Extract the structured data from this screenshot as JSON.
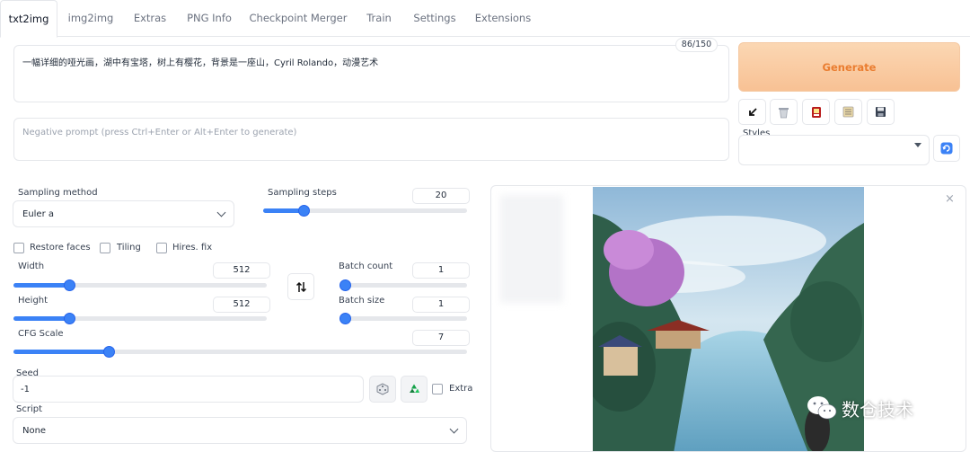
{
  "tabs": [
    {
      "label": "txt2img",
      "active": true
    },
    {
      "label": "img2img"
    },
    {
      "label": "Extras"
    },
    {
      "label": "PNG Info"
    },
    {
      "label": "Checkpoint Merger"
    },
    {
      "label": "Train"
    },
    {
      "label": "Settings"
    },
    {
      "label": "Extensions"
    }
  ],
  "prompt": {
    "value": "一幅详细的哑光画，湖中有宝塔，树上有樱花，背景是一座山，Cyril Rolando，动漫艺术",
    "token_counter": "86/150"
  },
  "negative_prompt": {
    "placeholder": "Negative prompt (press Ctrl+Enter or Alt+Enter to generate)"
  },
  "generate_label": "Generate",
  "toolbar_icons": [
    "arrow-icon",
    "trash-icon",
    "red-card-icon",
    "clipboard-icon",
    "save-icon"
  ],
  "styles": {
    "label": "Styles",
    "value": ""
  },
  "sampling": {
    "method_label": "Sampling method",
    "method_value": "Euler a",
    "steps_label": "Sampling steps",
    "steps_value": "20",
    "steps_fraction": 0.2
  },
  "options": {
    "restore_faces": "Restore faces",
    "tiling": "Tiling",
    "hires_fix": "Hires. fix"
  },
  "width": {
    "label": "Width",
    "value": "512",
    "fraction": 0.22
  },
  "height": {
    "label": "Height",
    "value": "512",
    "fraction": 0.22
  },
  "batch_count": {
    "label": "Batch count",
    "value": "1",
    "fraction": 0.0
  },
  "batch_size": {
    "label": "Batch size",
    "value": "1",
    "fraction": 0.0
  },
  "cfg_scale": {
    "label": "CFG Scale",
    "value": "7",
    "fraction": 0.21
  },
  "seed": {
    "label": "Seed",
    "value": "-1",
    "extra_label": "Extra"
  },
  "script": {
    "label": "Script",
    "value": "None"
  },
  "watermark": "数仓技术",
  "colors": {
    "accent": "#3b82f6",
    "generate_text": "#ea7d30"
  }
}
